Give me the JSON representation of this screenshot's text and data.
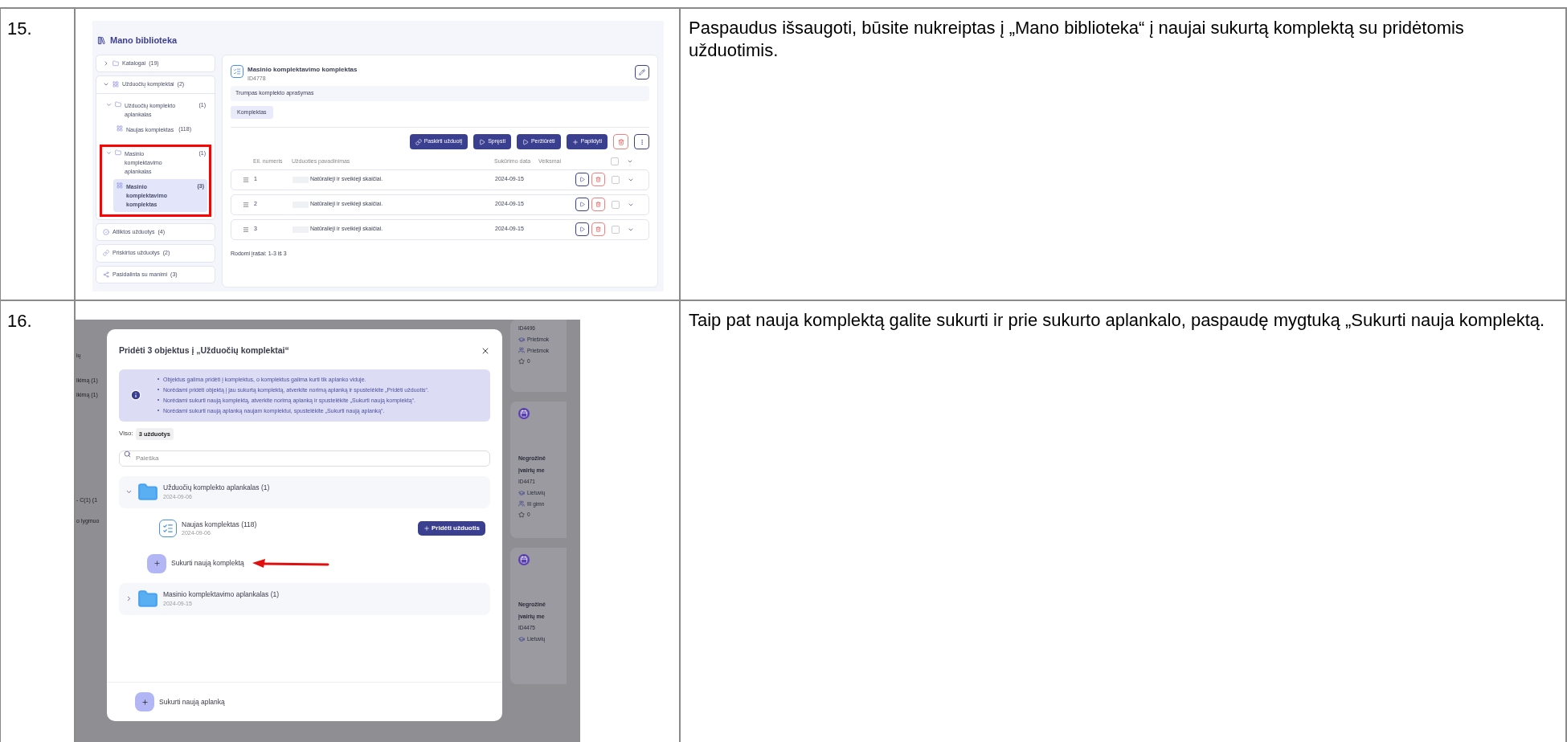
{
  "table": {
    "rows": [
      {
        "kind": "library",
        "number": "15.",
        "description": "Paspaudus išsaugoti, būsite nukreiptas į „Mano biblioteka“ į naujai sukurtą komplektą su pridėtomis užduotimis.",
        "screen": {
          "title": "Mano biblioteka",
          "sidebar": [
            {
              "kind": "group",
              "label": "Katalogai",
              "count": "(19)",
              "expanded": false
            },
            {
              "kind": "group",
              "label": "Užduočių komplektai",
              "count": "(2)",
              "expanded": true,
              "children": [
                {
                  "label": "Užduočių komplekto aplankalas",
                  "count": "(1)",
                  "expanded": true,
                  "highlighted": false,
                  "children": [
                    {
                      "label": "Naujas komplektas",
                      "count": "(118)",
                      "selected": false
                    }
                  ]
                },
                {
                  "label": "Masinio komplektavimo aplankalas",
                  "count": "(1)",
                  "expanded": true,
                  "highlighted": true,
                  "children": [
                    {
                      "label": "Masinio komplektavimo komplektas",
                      "count": "(3)",
                      "selected": true
                    }
                  ]
                }
              ]
            },
            {
              "kind": "link",
              "label": "Atliktos užduotys",
              "count": "(4)"
            },
            {
              "kind": "link",
              "label": "Priskirtos užduotys",
              "count": "(2)"
            },
            {
              "kind": "link",
              "label": "Pasidalinta su manimi",
              "count": "(3)"
            }
          ],
          "panel": {
            "title": "Masinio komplektavimo komplektas",
            "id": "ID4778",
            "description": "Trumpas komplekto aprašymas",
            "tabs": [
              {
                "label": "Komplektas",
                "selected": true
              }
            ],
            "actions": [
              "Paskirti užduotį",
              "Spręsti",
              "Peržiūrėti",
              "Papildyti"
            ],
            "columns": [
              "Eil. numeris",
              "Užduoties pavadinimas",
              "Sukūrimo data",
              "Veiksmai"
            ],
            "select_all_checked": false,
            "rows": [
              {
                "number": "1",
                "name": "Natūralieji ir sveikieji skaičiai.",
                "date": "2024-09-15",
                "checked": false
              },
              {
                "number": "2",
                "name": "Natūralieji ir sveikieji skaičiai.",
                "date": "2024-09-15",
                "checked": false
              },
              {
                "number": "3",
                "name": "Natūralieji ir sveikieji skaičiai.",
                "date": "2024-09-15",
                "checked": false
              }
            ],
            "footer": "Rodomi įrašai: 1-3 iš 3"
          }
        }
      },
      {
        "kind": "dialog",
        "number": "16.",
        "description": "Taip pat nauja komplektą galite sukurti ir prie sukurto aplankalo, paspaudę mygtuką „Sukurti nauja komplektą.",
        "screen": {
          "background_left": [
            "ių",
            "ikimą (1)",
            "ikimą (1)",
            "- C(1) (1",
            "o lygmuo"
          ],
          "background_cards": [
            {
              "id": "ID4496",
              "subject": "Priešmok",
              "grade": "Priešmok",
              "rating": "0"
            },
            {
              "title_lines": [
                "Negrožinė",
                "įvairių me"
              ],
              "id": "ID4471",
              "subject": "Lietuvių",
              "grade": "III gimn",
              "rating": "0"
            },
            {
              "title_lines": [
                "Negrožinė",
                "įvairių me"
              ],
              "id": "ID4475",
              "subject": "Lietuvių"
            }
          ],
          "dialog": {
            "title": "Pridėti 3 objektus į „Užduočių komplektai“",
            "info": [
              "Objektus galima pridėti į komplektus, o komplektus galima kurti tik aplanko viduje.",
              "Norėdami pridėti objektą į jau sukurtą komplektą, atverkite norimą aplanką ir spustelėkite „Pridėti užduotis“.",
              "Norėdami sukurti naują komplektą, atverkite norimą aplanką ir spustelėkite „Sukurti naują komplektą“.",
              "Norėdami sukurti naują aplanką naujam komplektui, spustelėkite „Sukurti naują aplanką“."
            ],
            "total_label": "Viso:",
            "total_badge": "3 užduotys",
            "search": {
              "placeholder": "Paieška"
            },
            "folders": [
              {
                "name": "Užduočių komplekto aplankalas (1)",
                "date": "2024-09-06",
                "expanded": true,
                "sets": [
                  {
                    "name": "Naujas komplektas (118)",
                    "date": "2024-09-06",
                    "action": "Pridėti užduotis"
                  }
                ],
                "create": {
                  "label": "Sukurti naują komplektą",
                  "pointed": true
                }
              },
              {
                "name": "Masinio komplektavimo aplankalas (1)",
                "date": "2024-09-15",
                "expanded": false
              }
            ],
            "footer_action": "Sukurti naują aplanką"
          }
        }
      }
    ]
  }
}
